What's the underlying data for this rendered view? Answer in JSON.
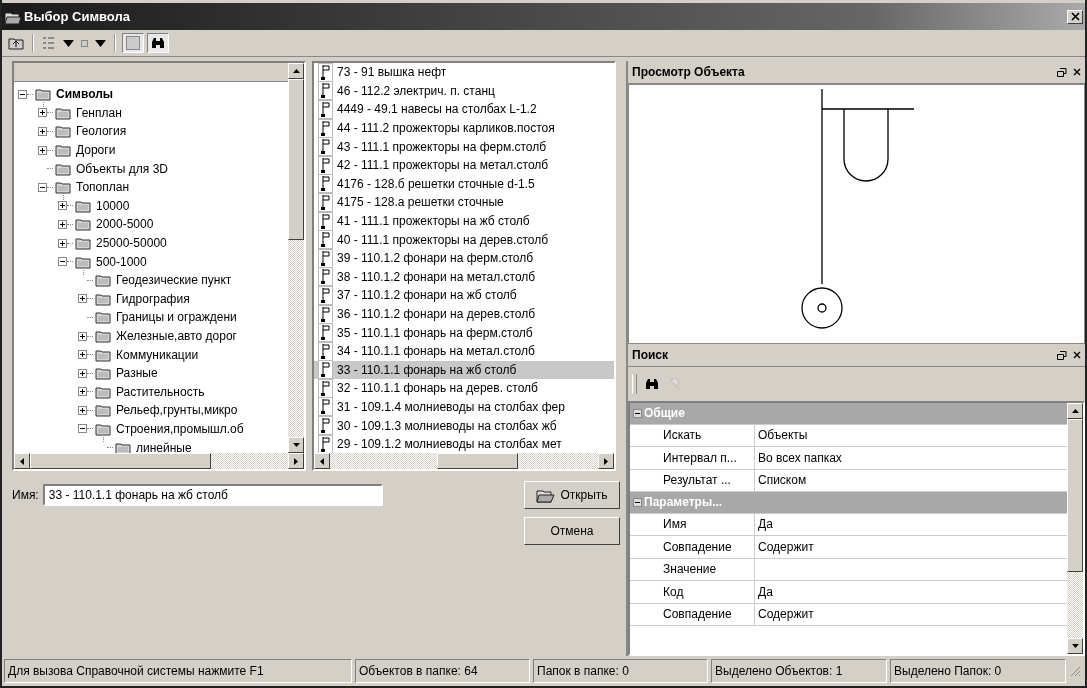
{
  "window": {
    "title": "Выбор Символа"
  },
  "tree": [
    {
      "label": "Символы",
      "has_children": true,
      "expanded": true,
      "children": [
        {
          "label": "Генплан",
          "has_children": true,
          "expanded": false
        },
        {
          "label": "Геология",
          "has_children": true,
          "expanded": false
        },
        {
          "label": "Дороги",
          "has_children": true,
          "expanded": false
        },
        {
          "label": "Объекты для 3D",
          "has_children": false
        },
        {
          "label": "Топоплан",
          "has_children": true,
          "expanded": true,
          "children": [
            {
              "label": "10000",
              "has_children": true,
              "expanded": false
            },
            {
              "label": "2000-5000",
              "has_children": true,
              "expanded": false
            },
            {
              "label": "25000-50000",
              "has_children": true,
              "expanded": false
            },
            {
              "label": "500-1000",
              "has_children": true,
              "expanded": true,
              "children": [
                {
                  "label": "Геодезические пункт",
                  "has_children": false
                },
                {
                  "label": "Гидрография",
                  "has_children": true,
                  "expanded": false
                },
                {
                  "label": "Границы и ограждени",
                  "has_children": false
                },
                {
                  "label": "Железные,авто дорог",
                  "has_children": true,
                  "expanded": false
                },
                {
                  "label": "Коммуникации",
                  "has_children": true,
                  "expanded": false
                },
                {
                  "label": "Разные",
                  "has_children": true,
                  "expanded": false
                },
                {
                  "label": "Растительность",
                  "has_children": true,
                  "expanded": false
                },
                {
                  "label": "Рельеф,грунты,микро",
                  "has_children": true,
                  "expanded": false
                },
                {
                  "label": "Строения,промышл.об",
                  "has_children": true,
                  "expanded": true,
                  "children": [
                    {
                      "label": "линейные",
                      "has_children": false
                    }
                  ]
                }
              ]
            }
          ]
        }
      ]
    }
  ],
  "symbols": [
    {
      "label": "73 - 91 вышка нефт",
      "selected": false
    },
    {
      "label": "46 - 112.2 электрич. п. станц",
      "selected": false
    },
    {
      "label": "4449 - 49.1 навесы на столбах L-1.2",
      "selected": false
    },
    {
      "label": "44 - 111.2 прожекторы карликов.постоя",
      "selected": false
    },
    {
      "label": "43 - 111.1 прожекторы на ферм.столб",
      "selected": false
    },
    {
      "label": "42 - 111.1 прожекторы на метал.столб",
      "selected": false
    },
    {
      "label": "4176 - 128.б решетки сточные d-1.5",
      "selected": false
    },
    {
      "label": "4175 - 128.а решетки сточные",
      "selected": false
    },
    {
      "label": "41 - 111.1 прожекторы на жб столб",
      "selected": false
    },
    {
      "label": "40 - 111.1 прожекторы на дерев.столб",
      "selected": false
    },
    {
      "label": "39 - 110.1.2 фонари на ферм.столб",
      "selected": false
    },
    {
      "label": "38 - 110.1.2 фонари на метал.столб",
      "selected": false
    },
    {
      "label": "37 - 110.1.2 фонари на жб столб",
      "selected": false
    },
    {
      "label": "36 - 110.1.2 фонари на дерев.столб",
      "selected": false
    },
    {
      "label": "35 - 110.1.1 фонарь на ферм.столб",
      "selected": false
    },
    {
      "label": "34 - 110.1.1 фонарь на  метал.столб",
      "selected": false
    },
    {
      "label": "33 - 110.1.1 фонарь на жб столб",
      "selected": true
    },
    {
      "label": "32 - 110.1.1 фонарь на дерев. столб",
      "selected": false
    },
    {
      "label": "31 - 109.1.4 молниеводы на столбах фер",
      "selected": false
    },
    {
      "label": "30 - 109.1.3 молниеводы на столбах жб",
      "selected": false
    },
    {
      "label": "29 - 109.1.2 молниеводы на столбах мет",
      "selected": false
    }
  ],
  "name_field": {
    "label": "Имя:",
    "value": "33 - 110.1.1 фонарь на жб столб"
  },
  "buttons": {
    "open": "Открыть",
    "cancel": "Отмена"
  },
  "preview": {
    "title": "Просмотр Объекта"
  },
  "search": {
    "title": "Поиск",
    "groups": [
      {
        "title": "Общие",
        "expanded": true,
        "rows": [
          {
            "name": "Искать",
            "value": "Объекты"
          },
          {
            "name": "Интервал п...",
            "value": "Во всех папках"
          },
          {
            "name": "Результат ...",
            "value": "Списком"
          }
        ]
      },
      {
        "title": "Параметры...",
        "expanded": true,
        "rows": [
          {
            "name": "Имя",
            "value": "Да"
          },
          {
            "name": "Совпадение",
            "value": "Содержит"
          },
          {
            "name": "Значение"
          },
          {
            "name": "Код",
            "value": "Да"
          },
          {
            "name": "Совпадение",
            "value": "Содержит"
          }
        ]
      }
    ]
  },
  "status_bar": [
    "Для вызова Справочной системы нажмите F1",
    "Объектов в папке: 64",
    "Папок в папке: 0",
    "Выделено Объектов: 1",
    "Выделено Папок: 0"
  ]
}
